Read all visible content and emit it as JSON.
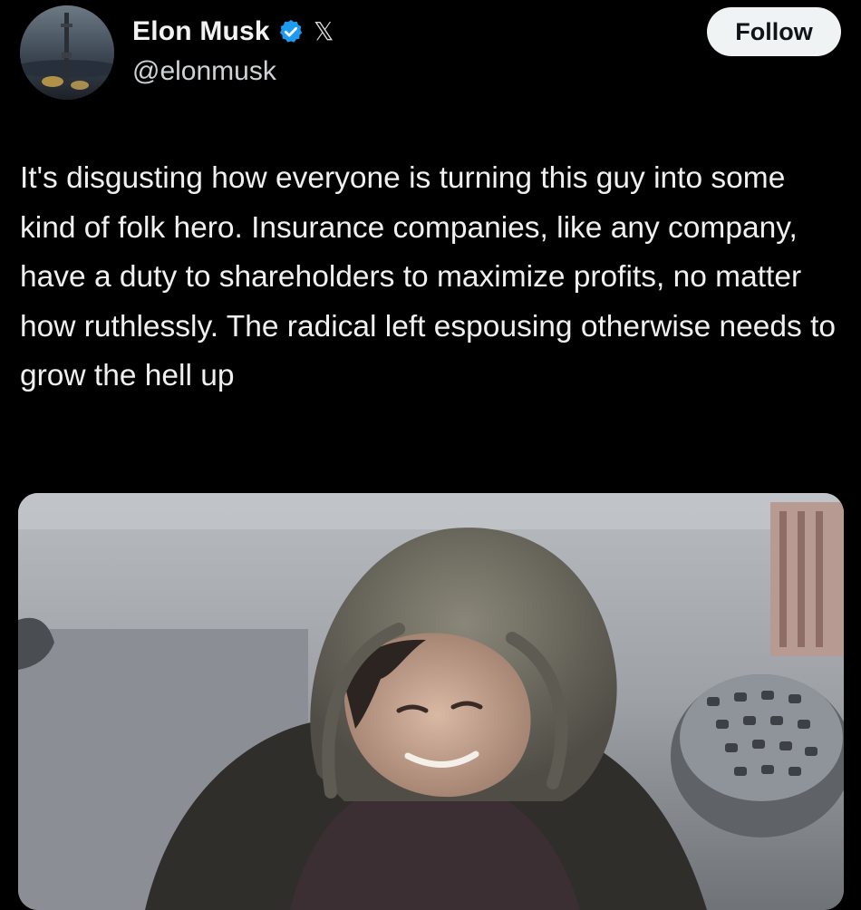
{
  "author": {
    "display_name": "Elon Musk",
    "handle": "@elonmusk",
    "verified_icon": "verified-badge-icon",
    "affiliation_icon": "x-logo-icon",
    "affiliation_glyph": "𝕏"
  },
  "actions": {
    "follow_label": "Follow"
  },
  "tweet": {
    "text": "It's disgusting how everyone is turning this guy into some kind of folk hero. Insurance companies, like any company, have a duty to shareholders to maximize profits, no matter how ruthlessly. The radical left espousing otherwise needs to grow the hell up"
  },
  "media": {
    "kind": "photo"
  },
  "colors": {
    "background": "#000000",
    "text": "#f0f0f0",
    "verified_blue": "#1d9bf0",
    "follow_bg": "#eff3f4"
  }
}
